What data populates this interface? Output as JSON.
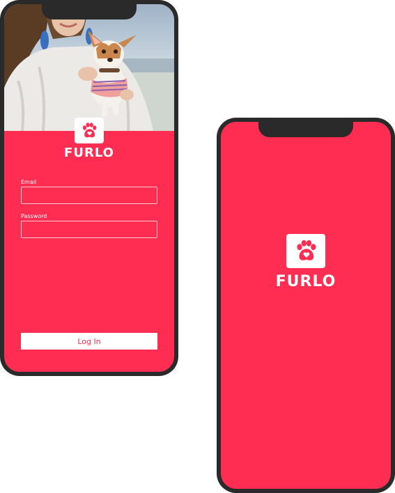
{
  "colors": {
    "brand": "#ff2d52",
    "frame": "#2a2a2a",
    "logo_background": "#ffffff"
  },
  "login_screen": {
    "hero_image": "woman-holding-chihuahua-photo",
    "logo_icon": "paw-heart-icon",
    "brand_name": "FURLO",
    "email": {
      "label": "Email",
      "value": "",
      "placeholder": ""
    },
    "password": {
      "label": "Password",
      "value": "",
      "placeholder": ""
    },
    "login_button_label": "Log In"
  },
  "splash_screen": {
    "logo_icon": "paw-heart-icon",
    "brand_name": "FURLO"
  }
}
